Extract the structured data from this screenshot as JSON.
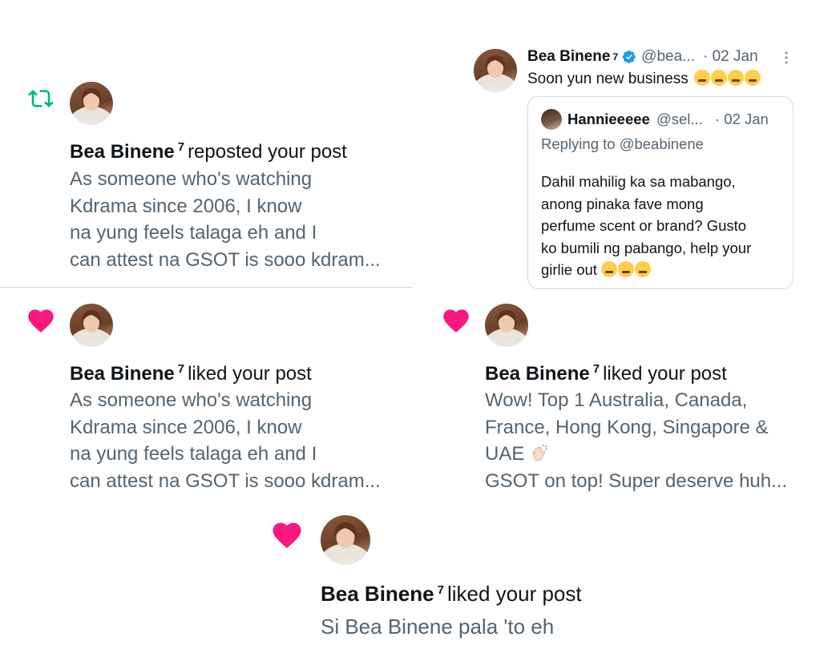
{
  "notifications": [
    {
      "type": "repost",
      "icon": "repost-icon",
      "user": "Bea Binene",
      "badge": "7",
      "action": "reposted your post",
      "text_lines": [
        "As someone who's watching",
        "Kdrama since 2006, I know",
        "na yung feels talaga eh and I",
        "can attest na GSOT is sooo kdram..."
      ]
    },
    {
      "type": "like",
      "icon": "heart-icon",
      "user": "Bea Binene",
      "badge": "7",
      "action": "liked your post",
      "text_lines": [
        "As someone who's watching",
        "Kdrama since 2006, I know",
        "na yung feels talaga eh and I",
        "can attest na GSOT is sooo kdram..."
      ]
    },
    {
      "type": "like",
      "icon": "heart-icon",
      "user": "Bea Binene",
      "badge": "7",
      "action": "liked your post",
      "text_lines": [
        "Wow! Top 1 Australia, Canada,",
        "France, Hong Kong, Singapore &",
        "UAE",
        "GSOT on top! Super deserve huh..."
      ]
    },
    {
      "type": "like",
      "icon": "heart-icon",
      "user": "Bea Binene",
      "badge": "7",
      "action": "liked your post",
      "text_lines": [
        "Si Bea Binene pala 'to eh"
      ]
    }
  ],
  "tweet": {
    "user": "Bea Binene",
    "badge": "7",
    "handle": "@bea...",
    "date": "· 02 Jan",
    "verified_icon": "verified-badge-icon",
    "more_icon": "more-options-icon",
    "text": "Soon yun new business",
    "quote": {
      "user": "Hannieeeee",
      "handle": "@sel...",
      "date": "· 02 Jan",
      "replying_to": "Replying to @beabinene",
      "body_lines": [
        "Dahil mahilig ka sa mabango,",
        "anong pinaka fave mong",
        "perfume scent or brand? Gusto",
        "ko bumili ng pabango, help your",
        "girlie out"
      ]
    }
  },
  "colors": {
    "repost": "#00ba7c",
    "like": "#f91880",
    "verified": "#1d9bf0",
    "secondary_text": "#536471",
    "divider": "#cfd9de"
  }
}
